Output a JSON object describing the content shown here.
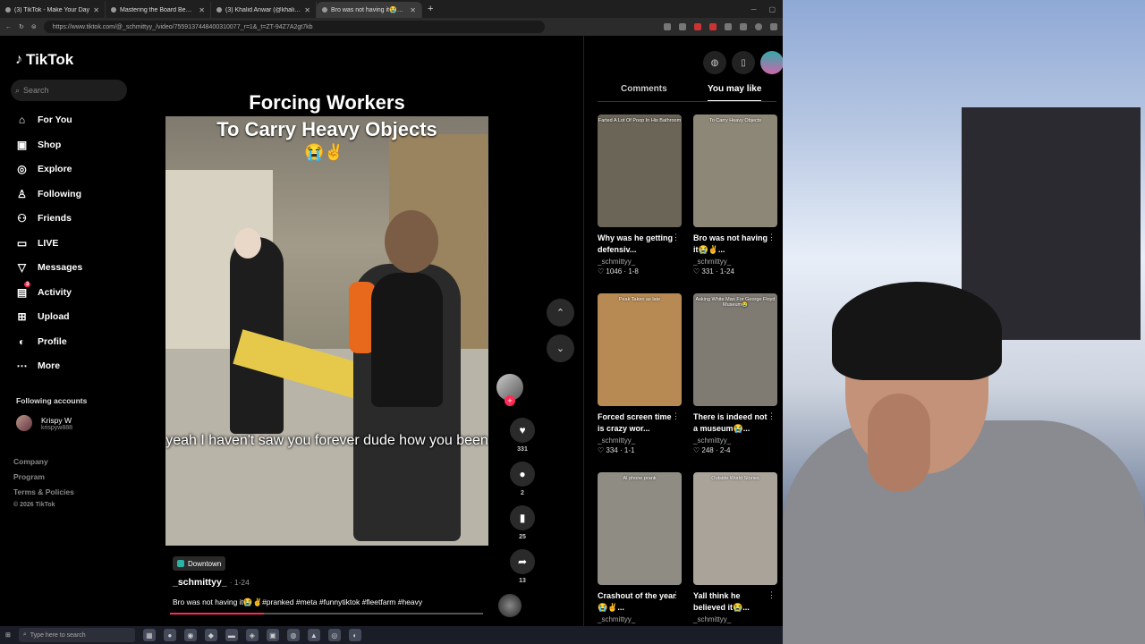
{
  "browser": {
    "tabs": [
      {
        "title": "(3) TikTok - Make Your Day",
        "active": false
      },
      {
        "title": "Mastering the Board Bender Tool",
        "active": false
      },
      {
        "title": "(3) Khalid Anwar (@khalidanwar_)",
        "active": false
      },
      {
        "title": "Bro was not having it😭✌️#p",
        "active": true
      }
    ],
    "url": "https://www.tiktok.com/@_schmittyy_/video/7559137448400310077_r=1&_t=ZT-94Z7A2gt7kb"
  },
  "sidebar": {
    "brand": "TikTok",
    "search_placeholder": "Search",
    "items": [
      {
        "label": "For You",
        "icon": "home-icon"
      },
      {
        "label": "Shop",
        "icon": "shop-bag-icon"
      },
      {
        "label": "Explore",
        "icon": "compass-icon"
      },
      {
        "label": "Following",
        "icon": "following-user-icon"
      },
      {
        "label": "Friends",
        "icon": "friends-icon"
      },
      {
        "label": "LIVE",
        "icon": "live-icon"
      },
      {
        "label": "Messages",
        "icon": "messages-icon"
      },
      {
        "label": "Activity",
        "icon": "activity-icon",
        "badge": "3"
      },
      {
        "label": "Upload",
        "icon": "upload-icon"
      },
      {
        "label": "Profile",
        "icon": "profile-avatar-icon"
      },
      {
        "label": "More",
        "icon": "more-dots-icon"
      }
    ],
    "following_heading": "Following accounts",
    "following": [
      {
        "name": "Krispy W",
        "handle": "krispyw888"
      }
    ],
    "footer": [
      "Company",
      "Program",
      "Terms & Policies"
    ],
    "copyright": "© 2026 TikTok"
  },
  "video": {
    "title_line1": "Forcing Workers",
    "title_line2": "To Carry Heavy Objects",
    "title_emoji": "😭✌️",
    "caption": "yeah I haven't saw you forever dude how you been",
    "location": "Downtown",
    "author": "_schmittyy_",
    "date": "· 1-24",
    "description": "Bro was not having it😭✌️#pranked #meta #funnytiktok #fleetfarm #heavy",
    "progress": 0.3,
    "likes": "331",
    "comments": "2",
    "saves": "25",
    "shares": "13"
  },
  "right_panel": {
    "tabs": [
      "Comments",
      "You may like"
    ],
    "active_tab": "You may like",
    "cards": [
      {
        "title": "Why was he getting defensiv...",
        "author": "_schmittyy_",
        "likes": "1046",
        "date": "1-8",
        "thumb_text": "Farted A Lot Of Poop In His Bathroom",
        "thumb_color": "#6b6557"
      },
      {
        "title": "Bro was not having it😭✌️...",
        "author": "_schmittyy_",
        "likes": "331",
        "date": "1-24",
        "thumb_text": "To Carry Heavy Objects",
        "thumb_color": "#8d8777"
      },
      {
        "title": "Forced screen time is crazy wor...",
        "author": "_schmittyy_",
        "likes": "334",
        "date": "1-1",
        "thumb_text": "Peak Taken as late",
        "thumb_color": "#b88a53"
      },
      {
        "title": "There is indeed not a museum😭...",
        "author": "_schmittyy_",
        "likes": "248",
        "date": "2-4",
        "thumb_text": "Asking White Man For George Floyd Museum😭",
        "thumb_color": "#7f7a72"
      },
      {
        "title": "Crashout of the year😭✌️...",
        "author": "_schmittyy_",
        "likes": "",
        "date": "",
        "thumb_text": "AI phone prank",
        "thumb_color": "#8f8c83"
      },
      {
        "title": "Yall think he believed it😭...",
        "author": "_schmittyy_",
        "likes": "",
        "date": "",
        "thumb_text": "Outside World Stories",
        "thumb_color": "#a9a39a"
      }
    ]
  },
  "taskbar": {
    "search_placeholder": "Type here to search"
  }
}
